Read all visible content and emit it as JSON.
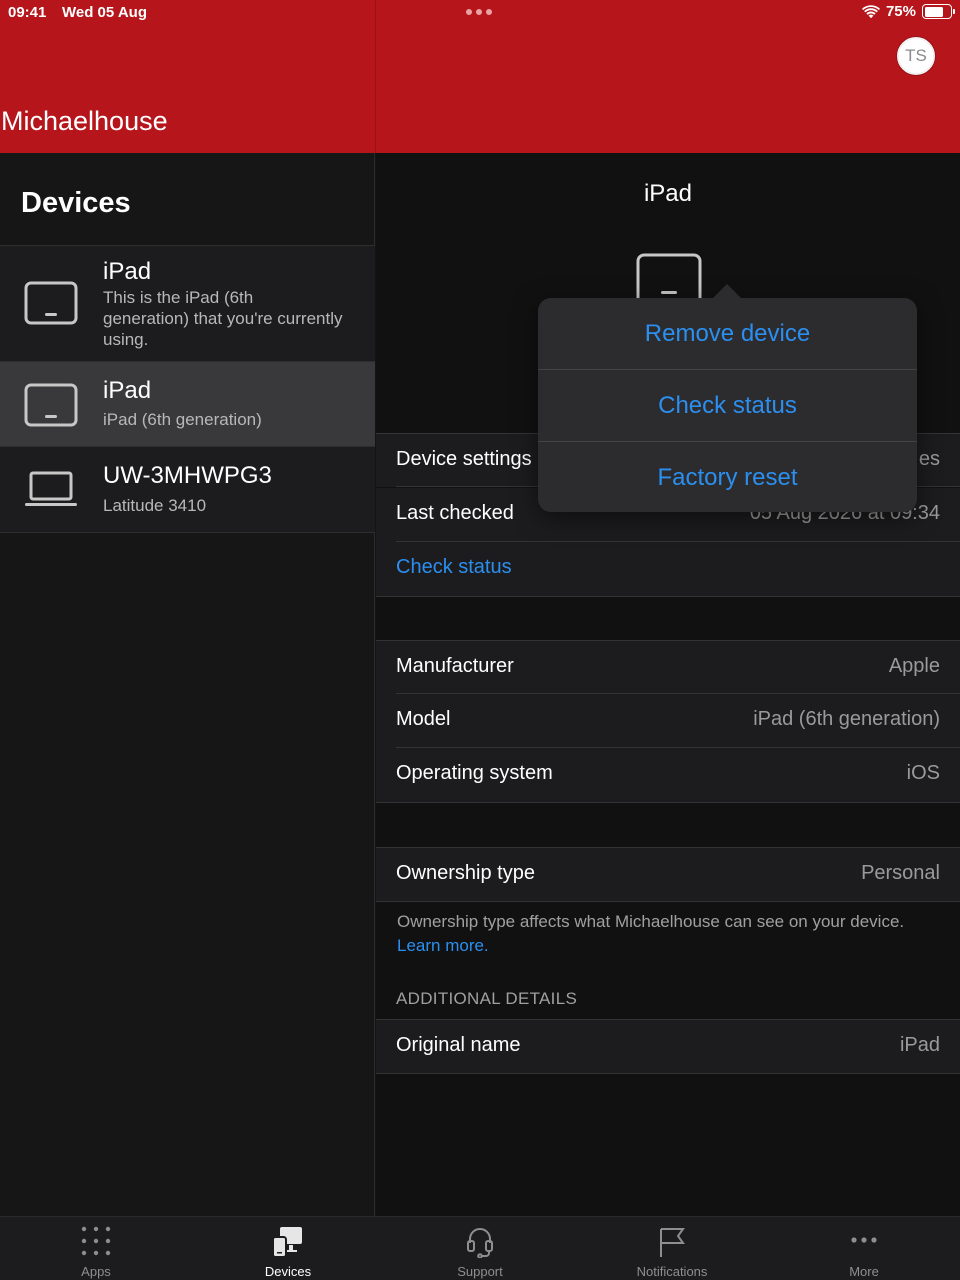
{
  "status_bar": {
    "time": "09:41",
    "date": "Wed 05 Aug",
    "battery": "75%",
    "battery_level": 0.75
  },
  "header": {
    "org_name": "Michaelhouse",
    "avatar_initials": "TS",
    "brand_color": "#b5151b"
  },
  "sidebar": {
    "title": "Devices",
    "devices": [
      {
        "name": "iPad",
        "subtitle": "This is the iPad (6th generation) that you're currently using.",
        "icon": "tablet-icon",
        "selected": false
      },
      {
        "name": "iPad",
        "subtitle": "iPad (6th generation)",
        "icon": "tablet-icon",
        "selected": true
      },
      {
        "name": "UW-3MHWPG3",
        "subtitle": "Latitude 3410",
        "icon": "laptop-icon",
        "selected": false
      }
    ]
  },
  "detail": {
    "title": "iPad",
    "hero_icon": "tablet-icon",
    "status_rows": [
      {
        "label": "Device settings",
        "value": "es"
      },
      {
        "label": "Last checked",
        "value": "05 Aug 2026 at 09:34"
      }
    ],
    "check_status_link": "Check status",
    "hardware_rows": [
      {
        "label": "Manufacturer",
        "value": "Apple"
      },
      {
        "label": "Model",
        "value": "iPad (6th generation)"
      },
      {
        "label": "Operating system",
        "value": "iOS"
      }
    ],
    "ownership": {
      "label": "Ownership type",
      "value": "Personal"
    },
    "ownership_note": "Ownership type affects what Michaelhouse can see on your device.",
    "ownership_learn_more": "Learn more.",
    "additional_header": "ADDITIONAL DETAILS",
    "original_name": {
      "label": "Original name",
      "value": "iPad"
    }
  },
  "popover_menu": {
    "items": [
      "Remove device",
      "Check status",
      "Factory reset"
    ],
    "accent_color": "#2b8ff0"
  },
  "tabbar": {
    "tabs": [
      {
        "label": "Apps",
        "icon": "apps-grid-icon",
        "active": false
      },
      {
        "label": "Devices",
        "icon": "devices-icon",
        "active": true
      },
      {
        "label": "Support",
        "icon": "headset-icon",
        "active": false
      },
      {
        "label": "Notifications",
        "icon": "flag-icon",
        "active": false
      },
      {
        "label": "More",
        "icon": "more-dots-icon",
        "active": false
      }
    ]
  }
}
